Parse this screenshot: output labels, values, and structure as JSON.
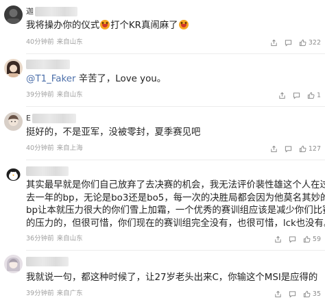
{
  "comments": [
    {
      "username": "迦",
      "text_before": "我将操办你的仪式",
      "emoji_1": "grin-emoji",
      "text_middle": "打个KR真闹麻了",
      "emoji_2": "grin-emoji",
      "time": "40分钟前",
      "source": "来自山东",
      "like_count": "322"
    },
    {
      "username": "",
      "mention": "@T1_Faker",
      "text": " 辛苦了，Love you。",
      "time": "39分钟前",
      "source": "来自山东",
      "like_count": "1"
    },
    {
      "username": "E",
      "text": "挺好的，不是亚军，没被零封，夏季赛见吧",
      "time": "40分钟前",
      "source": "来自上海",
      "like_count": "127"
    },
    {
      "username": "",
      "lines": [
        "其实最早就是你们自己放弃了去决赛的机会，我无法评价裴性雄这个人在过",
        "去一年的bp，无论是bo3还是bo5，每一次的决胜局都会因为他莫名其妙的",
        "bp让本就压力很大的你们雪上加霜，一个优秀的赛训组应该是减少你们比赛",
        "的压力的，但很可惜，你们现在的赛训组完全没有，也很可惜，lck也没有。"
      ],
      "time": "36分钟前",
      "source": "来自山东",
      "like_count": "59"
    },
    {
      "username": "",
      "text": "我就说一句，都这种时候了，让27岁老头出来C，你输这个MSI是应得的",
      "time": "39分钟前",
      "source": "来自广东",
      "like_count": "35"
    }
  ],
  "colors": {
    "mention": "#4a6ea9",
    "meta": "#a0a0a0",
    "emoji": "#f6a623"
  }
}
